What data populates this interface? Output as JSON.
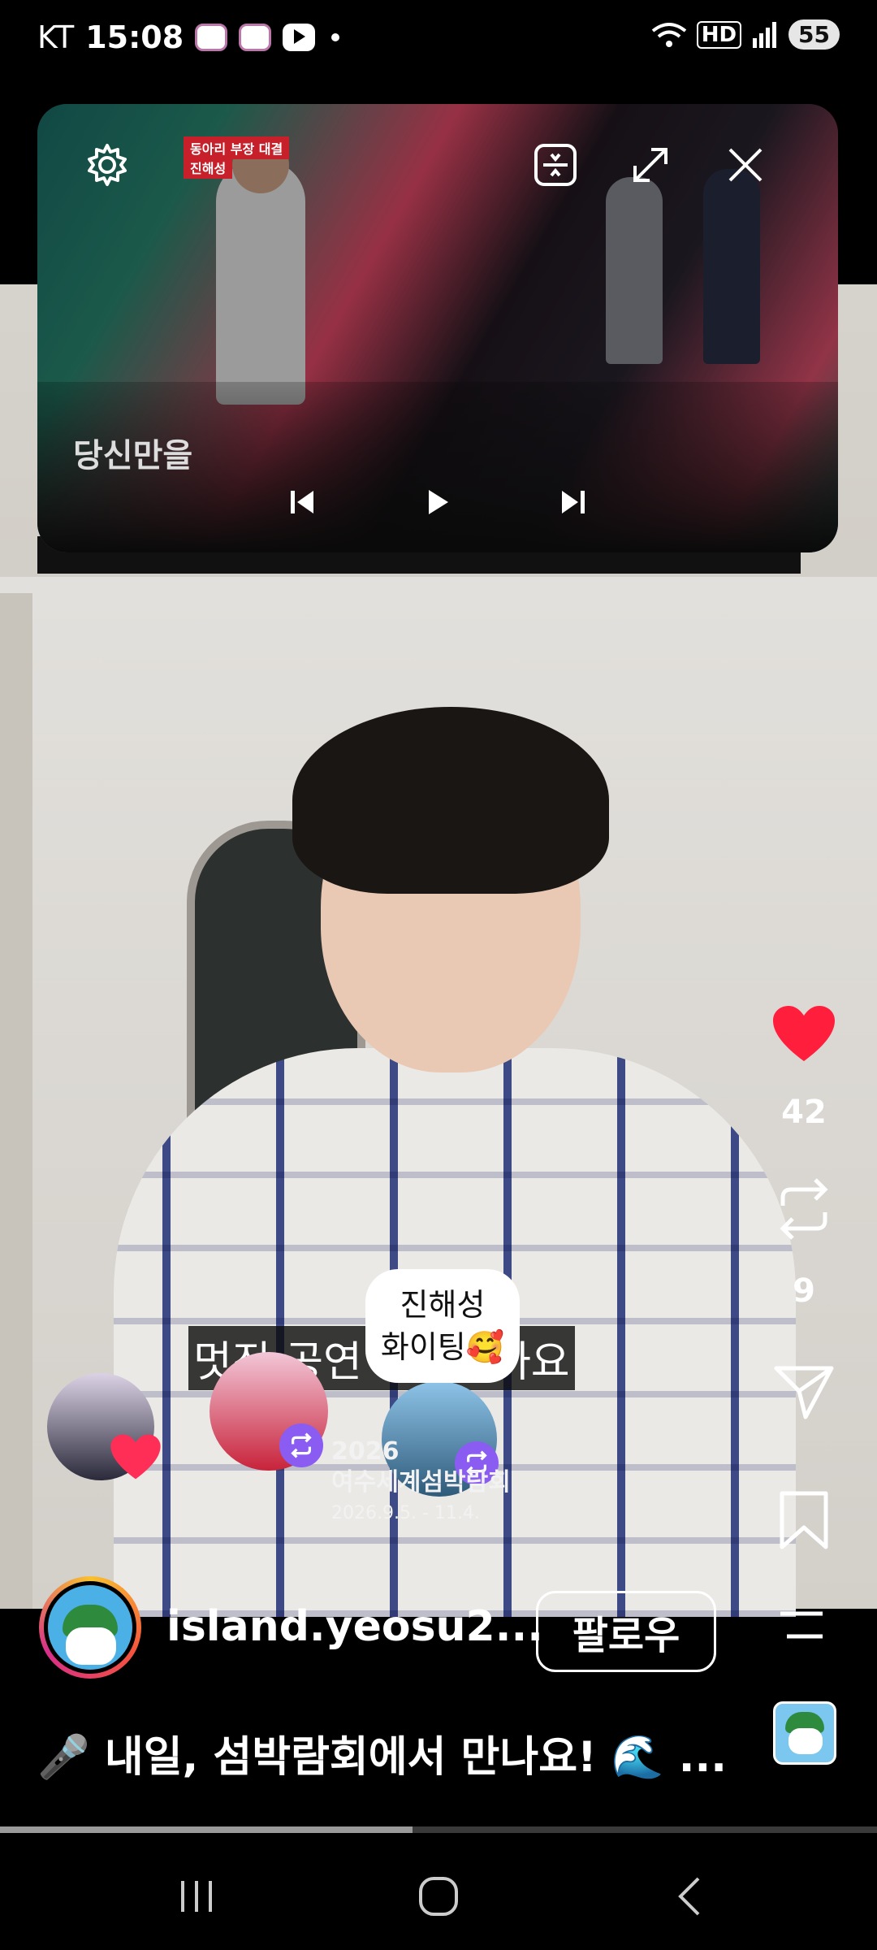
{
  "status_bar": {
    "carrier": "KT",
    "time": "15:08",
    "battery": "55",
    "network_badge": "HD"
  },
  "pip": {
    "show_title": "동아리 부장 대결",
    "performer_label": "진해성",
    "caption": "당신만을"
  },
  "video": {
    "subtitle_bottom": "멋진 공연         릴테니까요"
  },
  "sticker": {
    "text": "진해성\n화이팅🥰",
    "event_title_line1": "2026",
    "event_title_line2": "여수세계섬박람회",
    "event_dates": "2026.9.5. - 11.4."
  },
  "actions": {
    "likes": "42",
    "reposts": "9"
  },
  "account": {
    "username": "island.yeosu2...",
    "follow_label": "팔로우"
  },
  "post": {
    "caption": "🎤 내일, 섬박람회에서 만나요! 🌊 ..."
  },
  "playback": {
    "progress_fraction": 0.47
  },
  "icons": {
    "like": "heart-icon",
    "repost": "repost-icon",
    "share": "send-icon",
    "save": "bookmark-icon",
    "more": "menu-icon"
  },
  "colors": {
    "like_red": "#ff1e3c",
    "repost_badge": "#8a5cf2"
  }
}
